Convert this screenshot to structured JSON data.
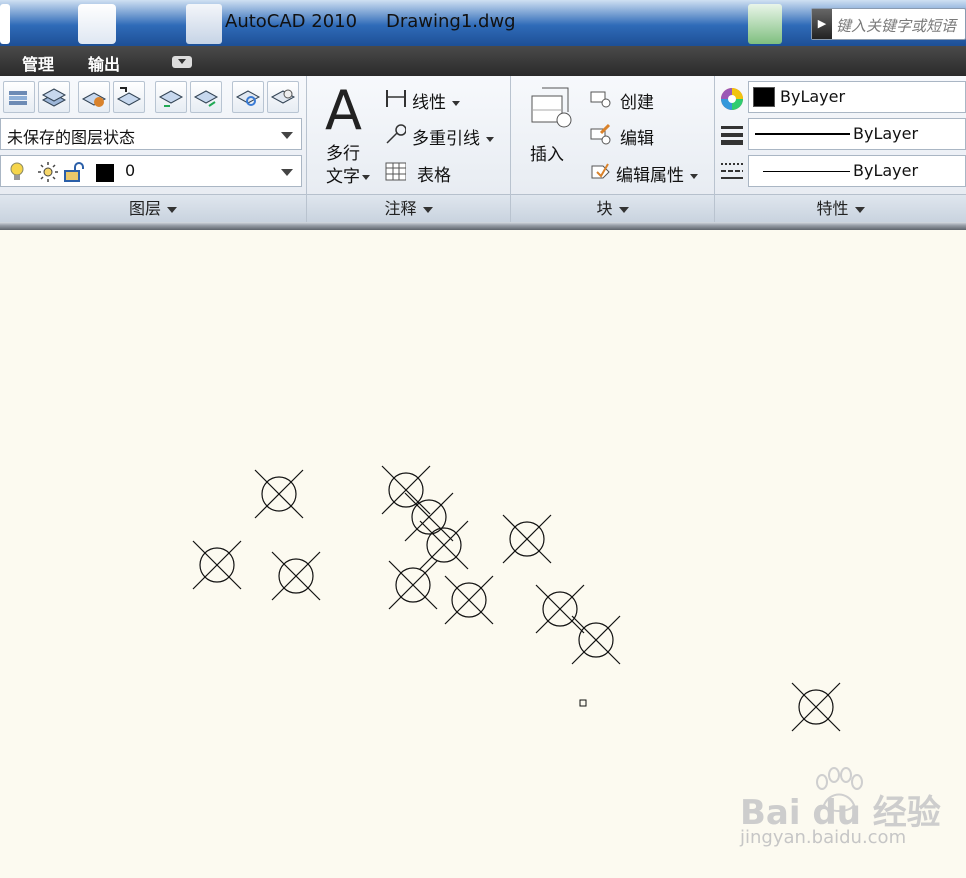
{
  "titlebar": {
    "app": "AutoCAD 2010",
    "file": "Drawing1.dwg",
    "search_placeholder": "键入关键字或短语"
  },
  "menu": {
    "items": [
      "管理",
      "输出"
    ]
  },
  "ribbon": {
    "layer_panel": {
      "title": "图层",
      "state_combo": "未保存的图层状态",
      "layer_combo": "0",
      "layer_color": "#000000",
      "tool_icons": [
        "layer-properties-icon",
        "layer-state-icon",
        "layer-match-icon",
        "layer-previous-icon",
        "layer-isolate-icon",
        "layer-unisolate-icon",
        "layer-freeze-icon",
        "layer-off-icon"
      ]
    },
    "annotation_panel": {
      "title": "注释",
      "mtext_line1": "多行",
      "mtext_line2": "文字",
      "linear": "线性",
      "multileader": "多重引线",
      "table": "表格"
    },
    "block_panel": {
      "title": "块",
      "insert": "插入",
      "create": "创建",
      "edit": "编辑",
      "edit_attributes": "编辑属性"
    },
    "properties_panel": {
      "title": "特性",
      "color": "ByLayer",
      "lineweight": "ByLayer",
      "linetype": "ByLayer"
    }
  },
  "watermark": {
    "brand": "Bai du 经验",
    "url": "jingyan.baidu.com"
  }
}
